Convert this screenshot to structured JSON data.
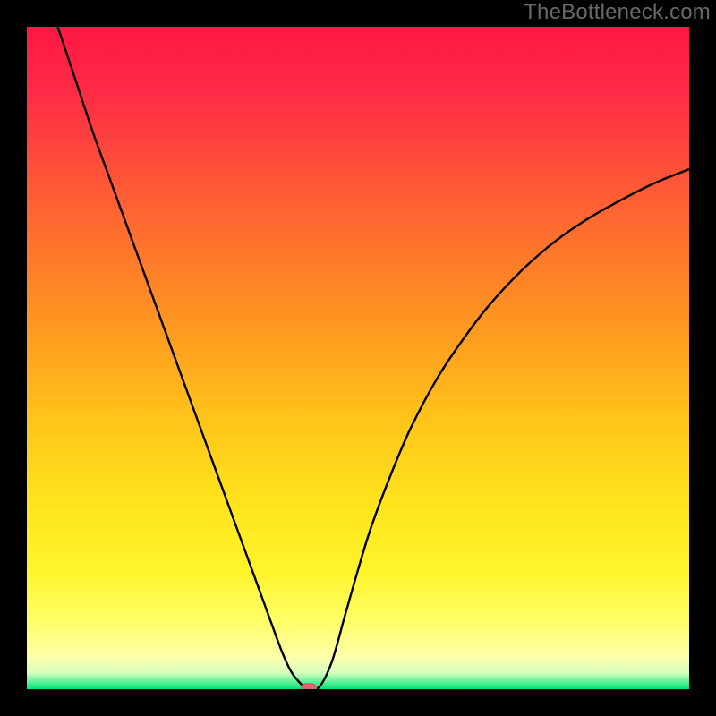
{
  "watermark": "TheBottleneck.com",
  "colors": {
    "frame": "#000000",
    "curve": "#000000",
    "marker": "#cf6a6a",
    "gradient_stops": [
      {
        "offset": 0.0,
        "color": "#ff1744"
      },
      {
        "offset": 0.1,
        "color": "#ff2b46"
      },
      {
        "offset": 0.22,
        "color": "#ff5238"
      },
      {
        "offset": 0.35,
        "color": "#ff7a2a"
      },
      {
        "offset": 0.48,
        "color": "#ffa01e"
      },
      {
        "offset": 0.6,
        "color": "#ffc61a"
      },
      {
        "offset": 0.72,
        "color": "#ffe41c"
      },
      {
        "offset": 0.82,
        "color": "#fff42a"
      },
      {
        "offset": 0.9,
        "color": "#ffff6a"
      },
      {
        "offset": 0.95,
        "color": "#ffffaa"
      },
      {
        "offset": 0.975,
        "color": "#d8ffc0"
      },
      {
        "offset": 1.0,
        "color": "#00e676"
      }
    ]
  },
  "chart_data": {
    "type": "line",
    "title": "",
    "xlabel": "",
    "ylabel": "",
    "xlim": [
      0,
      100
    ],
    "ylim": [
      0,
      100
    ],
    "x": [
      0,
      2,
      4,
      6,
      8,
      10,
      12,
      14,
      16,
      18,
      20,
      22,
      24,
      26,
      28,
      30,
      32,
      34,
      36,
      38,
      39,
      40,
      41,
      42,
      44,
      46,
      48,
      50,
      52,
      55,
      58,
      62,
      66,
      70,
      75,
      80,
      85,
      90,
      95,
      100
    ],
    "y": [
      114,
      108,
      102,
      96,
      90,
      84,
      78.5,
      73,
      67.5,
      62,
      56.5,
      51,
      45.5,
      40,
      34.5,
      29,
      23.5,
      18,
      12.5,
      7,
      4.5,
      2.5,
      1.2,
      0.4,
      0.2,
      4,
      11,
      18,
      24.5,
      32.5,
      39.5,
      47,
      53,
      58.2,
      63.5,
      67.8,
      71.2,
      74,
      76.5,
      78.5
    ],
    "minimum_marker": {
      "x": 42.5,
      "y": 0.1
    },
    "annotations": []
  }
}
